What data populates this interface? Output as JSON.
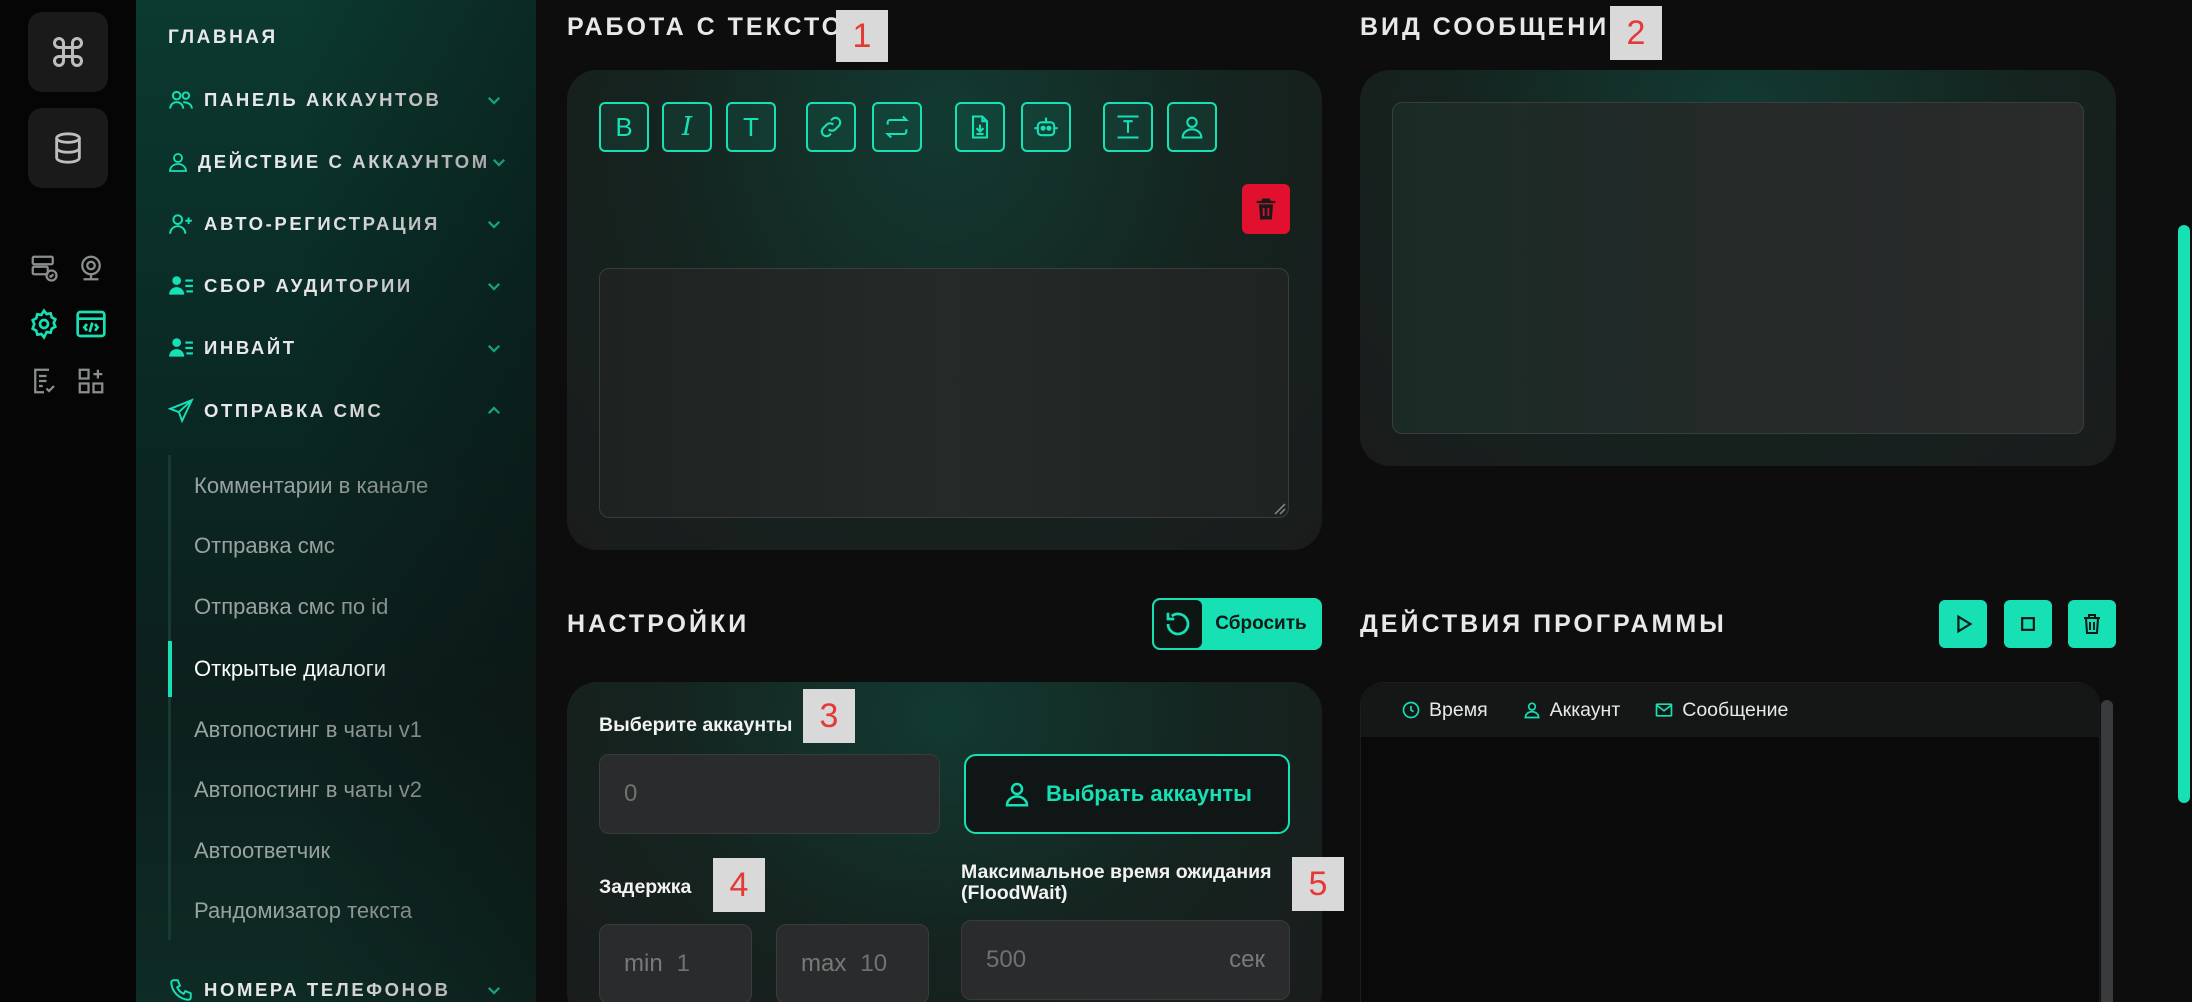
{
  "sidebar": {
    "home": "ГЛАВНАЯ",
    "items": [
      {
        "label": "ПАНЕЛЬ АККАУНТОВ",
        "icon": "users-icon"
      },
      {
        "label": "ДЕЙСТВИЕ С АККАУНТОМ",
        "icon": "user-icon"
      },
      {
        "label": "АВТО-РЕГИСТРАЦИЯ",
        "icon": "user-plus-icon"
      },
      {
        "label": "СБОР АУДИТОРИИ",
        "icon": "user-list-icon"
      },
      {
        "label": "ИНВАЙТ",
        "icon": "user-list-icon"
      },
      {
        "label": "ОТПРАВКА СМС",
        "icon": "send-icon",
        "expanded": true
      },
      {
        "label": "НОМЕРА ТЕЛЕФОНОВ",
        "icon": "phone-icon"
      }
    ],
    "sub_items": [
      "Комментарии в канале",
      "Отправка смс",
      "Отправка смс по id",
      "Открытые диалоги",
      "Автопостинг в чаты v1",
      "Автопостинг в чаты v2",
      "Автоответчик",
      "Рандомизатор текста"
    ],
    "active_sub": "Открытые диалоги"
  },
  "text_section": {
    "title": "РАБОТА С ТЕКСТОМ",
    "badge": "1",
    "toolbar": [
      "B",
      "I",
      "T",
      "link-icon",
      "repeat-icon",
      "file-download-icon",
      "bot-icon",
      "text-format-icon",
      "user-icon"
    ]
  },
  "preview_section": {
    "title": "ВИД СООБЩЕНИЯ",
    "badge": "2"
  },
  "settings": {
    "title": "НАСТРОЙКИ",
    "reset_label": "Сбросить",
    "accounts_label": "Выберите аккаунты",
    "accounts_badge": "3",
    "accounts_value": "0",
    "choose_accounts": "Выбрать аккаунты",
    "delay_label": "Задержка",
    "delay_badge": "4",
    "min_prefix": "min",
    "min_value": "1",
    "max_prefix": "max",
    "max_value": "10",
    "flood_label_1": "Максимальное время ожидания",
    "flood_label_2": "(FloodWait)",
    "flood_badge": "5",
    "flood_value": "500",
    "flood_suffix": "сек"
  },
  "actions": {
    "title": "ДЕЙСТВИЯ ПРОГРАММЫ",
    "columns": [
      "Время",
      "Аккаунт",
      "Сообщение"
    ]
  },
  "colors": {
    "accent": "#17e0b5",
    "danger": "#e0102e",
    "background": "#0d0d0e"
  }
}
